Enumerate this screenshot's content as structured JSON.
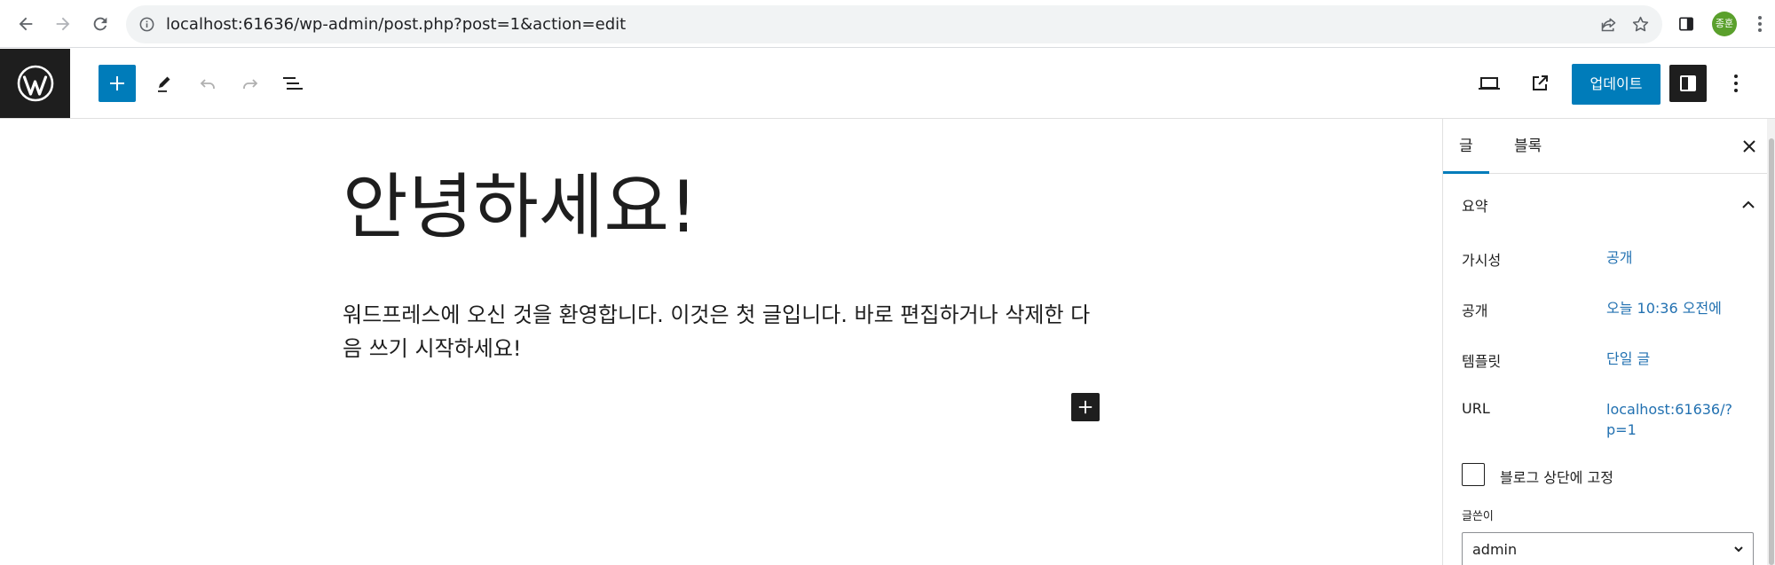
{
  "browser": {
    "url": "localhost:61636/wp-admin/post.php?post=1&action=edit",
    "profile_initials": "종훈"
  },
  "toolbar": {
    "update_label": "업데이트"
  },
  "post": {
    "title": "안녕하세요!",
    "body": "워드프레스에 오신 것을 환영합니다. 이것은 첫 글입니다. 바로 편집하거나 삭제한 다음 쓰기 시작하세요!"
  },
  "sidebar": {
    "tabs": [
      {
        "label": "글",
        "active": true
      },
      {
        "label": "블록",
        "active": false
      }
    ],
    "panel_title": "요약",
    "rows": [
      {
        "label": "가시성",
        "value": "공개"
      },
      {
        "label": "공개",
        "value": "오늘 10:36 오전에"
      },
      {
        "label": "템플릿",
        "value": "단일 글"
      },
      {
        "label": "URL",
        "value": "localhost:61636/?p=1"
      }
    ],
    "sticky_label": "블로그 상단에 고정",
    "sticky_checked": false,
    "author_label": "글쓴이",
    "author_value": "admin"
  },
  "colors": {
    "accent": "#007cba",
    "link": "#2271b1",
    "dark": "#1e1e1e"
  },
  "icons": [
    "back-icon",
    "forward-icon",
    "reload-icon",
    "info-icon",
    "share-icon",
    "star-icon",
    "side-panel-icon",
    "chrome-menu-icon",
    "wordpress-logo-icon",
    "plus-icon",
    "pencil-icon",
    "undo-icon",
    "redo-icon",
    "list-view-icon",
    "preview-icon",
    "external-link-icon",
    "settings-icon",
    "more-icon",
    "close-icon",
    "chevron-up-icon",
    "chevron-down-icon"
  ]
}
